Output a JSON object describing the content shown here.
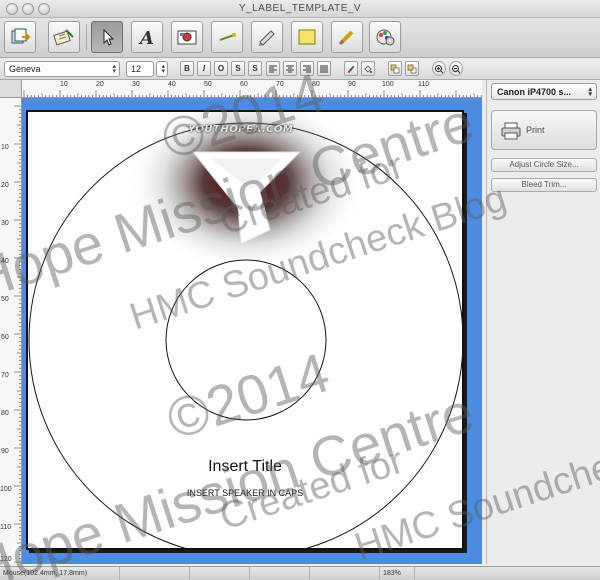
{
  "window": {
    "title": "Y_LABEL_TEMPLATE_V"
  },
  "format": {
    "font_name": "Geneva",
    "font_size": "12"
  },
  "ruler": {
    "h_labels": [
      "10",
      "20",
      "30",
      "40",
      "50",
      "60",
      "70",
      "80",
      "90",
      "100",
      "110"
    ],
    "v_labels": [
      "10",
      "20",
      "30",
      "40",
      "50",
      "60",
      "70",
      "80",
      "90",
      "100",
      "110",
      "120"
    ]
  },
  "canvas": {
    "logo_text": "YOUTHOPEA.COM",
    "title": "Insert Title",
    "speaker": "INSERT SPEAKER IN CAPS"
  },
  "sidebar": {
    "printer": "Canon iP4700 s...",
    "print_label": "Print",
    "adjust_label": "Adjust Circle Size...",
    "bleed_label": "Bleed Trim..."
  },
  "status": {
    "mouse": "Mouse(102.4mm, 17.8mm)",
    "zoom": "183%"
  },
  "watermark": {
    "line1": "©2014",
    "line2": "Hope Mission Centre",
    "line3": "Created for",
    "line4": "HMC Soundcheck Blog"
  },
  "colors": {
    "canvas_bg": "#4c8de3",
    "logo_shadow": "#6b0f12"
  }
}
